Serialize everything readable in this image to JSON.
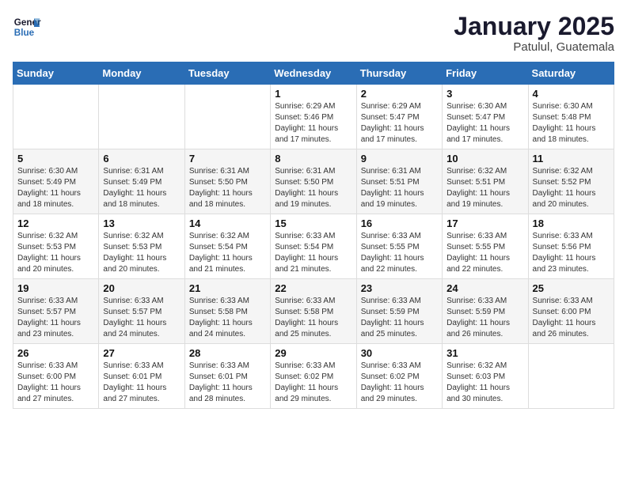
{
  "header": {
    "logo_line1": "General",
    "logo_line2": "Blue",
    "month": "January 2025",
    "location": "Patulul, Guatemala"
  },
  "weekdays": [
    "Sunday",
    "Monday",
    "Tuesday",
    "Wednesday",
    "Thursday",
    "Friday",
    "Saturday"
  ],
  "weeks": [
    [
      {
        "day": "",
        "text": ""
      },
      {
        "day": "",
        "text": ""
      },
      {
        "day": "",
        "text": ""
      },
      {
        "day": "1",
        "text": "Sunrise: 6:29 AM\nSunset: 5:46 PM\nDaylight: 11 hours\nand 17 minutes."
      },
      {
        "day": "2",
        "text": "Sunrise: 6:29 AM\nSunset: 5:47 PM\nDaylight: 11 hours\nand 17 minutes."
      },
      {
        "day": "3",
        "text": "Sunrise: 6:30 AM\nSunset: 5:47 PM\nDaylight: 11 hours\nand 17 minutes."
      },
      {
        "day": "4",
        "text": "Sunrise: 6:30 AM\nSunset: 5:48 PM\nDaylight: 11 hours\nand 18 minutes."
      }
    ],
    [
      {
        "day": "5",
        "text": "Sunrise: 6:30 AM\nSunset: 5:49 PM\nDaylight: 11 hours\nand 18 minutes."
      },
      {
        "day": "6",
        "text": "Sunrise: 6:31 AM\nSunset: 5:49 PM\nDaylight: 11 hours\nand 18 minutes."
      },
      {
        "day": "7",
        "text": "Sunrise: 6:31 AM\nSunset: 5:50 PM\nDaylight: 11 hours\nand 18 minutes."
      },
      {
        "day": "8",
        "text": "Sunrise: 6:31 AM\nSunset: 5:50 PM\nDaylight: 11 hours\nand 19 minutes."
      },
      {
        "day": "9",
        "text": "Sunrise: 6:31 AM\nSunset: 5:51 PM\nDaylight: 11 hours\nand 19 minutes."
      },
      {
        "day": "10",
        "text": "Sunrise: 6:32 AM\nSunset: 5:51 PM\nDaylight: 11 hours\nand 19 minutes."
      },
      {
        "day": "11",
        "text": "Sunrise: 6:32 AM\nSunset: 5:52 PM\nDaylight: 11 hours\nand 20 minutes."
      }
    ],
    [
      {
        "day": "12",
        "text": "Sunrise: 6:32 AM\nSunset: 5:53 PM\nDaylight: 11 hours\nand 20 minutes."
      },
      {
        "day": "13",
        "text": "Sunrise: 6:32 AM\nSunset: 5:53 PM\nDaylight: 11 hours\nand 20 minutes."
      },
      {
        "day": "14",
        "text": "Sunrise: 6:32 AM\nSunset: 5:54 PM\nDaylight: 11 hours\nand 21 minutes."
      },
      {
        "day": "15",
        "text": "Sunrise: 6:33 AM\nSunset: 5:54 PM\nDaylight: 11 hours\nand 21 minutes."
      },
      {
        "day": "16",
        "text": "Sunrise: 6:33 AM\nSunset: 5:55 PM\nDaylight: 11 hours\nand 22 minutes."
      },
      {
        "day": "17",
        "text": "Sunrise: 6:33 AM\nSunset: 5:55 PM\nDaylight: 11 hours\nand 22 minutes."
      },
      {
        "day": "18",
        "text": "Sunrise: 6:33 AM\nSunset: 5:56 PM\nDaylight: 11 hours\nand 23 minutes."
      }
    ],
    [
      {
        "day": "19",
        "text": "Sunrise: 6:33 AM\nSunset: 5:57 PM\nDaylight: 11 hours\nand 23 minutes."
      },
      {
        "day": "20",
        "text": "Sunrise: 6:33 AM\nSunset: 5:57 PM\nDaylight: 11 hours\nand 24 minutes."
      },
      {
        "day": "21",
        "text": "Sunrise: 6:33 AM\nSunset: 5:58 PM\nDaylight: 11 hours\nand 24 minutes."
      },
      {
        "day": "22",
        "text": "Sunrise: 6:33 AM\nSunset: 5:58 PM\nDaylight: 11 hours\nand 25 minutes."
      },
      {
        "day": "23",
        "text": "Sunrise: 6:33 AM\nSunset: 5:59 PM\nDaylight: 11 hours\nand 25 minutes."
      },
      {
        "day": "24",
        "text": "Sunrise: 6:33 AM\nSunset: 5:59 PM\nDaylight: 11 hours\nand 26 minutes."
      },
      {
        "day": "25",
        "text": "Sunrise: 6:33 AM\nSunset: 6:00 PM\nDaylight: 11 hours\nand 26 minutes."
      }
    ],
    [
      {
        "day": "26",
        "text": "Sunrise: 6:33 AM\nSunset: 6:00 PM\nDaylight: 11 hours\nand 27 minutes."
      },
      {
        "day": "27",
        "text": "Sunrise: 6:33 AM\nSunset: 6:01 PM\nDaylight: 11 hours\nand 27 minutes."
      },
      {
        "day": "28",
        "text": "Sunrise: 6:33 AM\nSunset: 6:01 PM\nDaylight: 11 hours\nand 28 minutes."
      },
      {
        "day": "29",
        "text": "Sunrise: 6:33 AM\nSunset: 6:02 PM\nDaylight: 11 hours\nand 29 minutes."
      },
      {
        "day": "30",
        "text": "Sunrise: 6:33 AM\nSunset: 6:02 PM\nDaylight: 11 hours\nand 29 minutes."
      },
      {
        "day": "31",
        "text": "Sunrise: 6:32 AM\nSunset: 6:03 PM\nDaylight: 11 hours\nand 30 minutes."
      },
      {
        "day": "",
        "text": ""
      }
    ]
  ]
}
